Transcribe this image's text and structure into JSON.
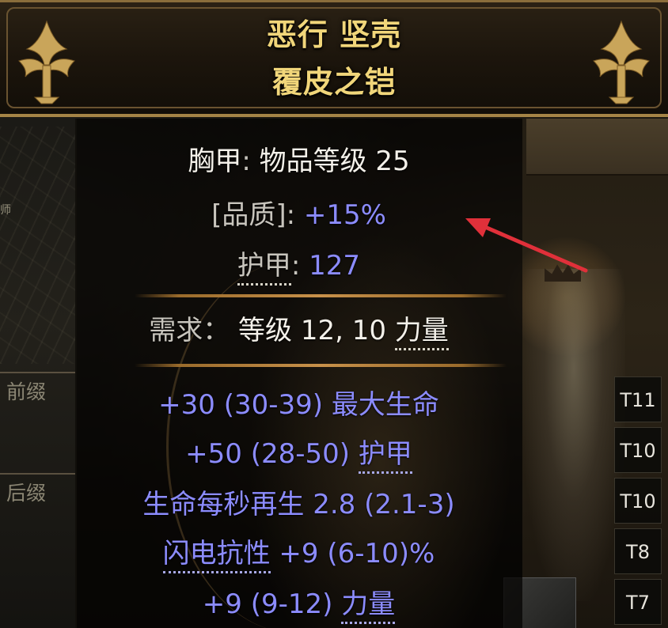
{
  "item": {
    "name_line1": "恶行 坚壳",
    "name_line2": "覆皮之铠"
  },
  "properties": {
    "type_label": "胸甲",
    "item_level_label": "物品等级",
    "item_level_value": "25",
    "quality_label": "[品质]:",
    "quality_value": "+15%",
    "armour_label": "护甲",
    "armour_value": "127"
  },
  "requirements": {
    "label": "需求：",
    "level_text": "等级 12, 10",
    "stat_text": "力量"
  },
  "modifiers": [
    {
      "prefix": "+30 (30-39) 最大生命",
      "keyword": "",
      "suffix": "",
      "tier": "T11"
    },
    {
      "prefix": "+50 (28-50) ",
      "keyword": "护甲",
      "suffix": "",
      "tier": "T10"
    },
    {
      "prefix": "生命每秒再生 2.8 (2.1-3)",
      "keyword": "",
      "suffix": "",
      "tier": "T10"
    },
    {
      "prefix": "",
      "keyword": "闪电抗性",
      "suffix": " +9 (6-10)%",
      "tier": "T8"
    },
    {
      "prefix": "+9 (9-12) ",
      "keyword": "力量",
      "suffix": "",
      "tier": "T7"
    }
  ],
  "background": {
    "prefix_label": "前缀",
    "suffix_label": "后缀",
    "small_tag": "师"
  },
  "colors": {
    "name_gold": "#f1d67a",
    "magic_blue": "#8c8cff",
    "annotation_arrow": "#e0303a"
  }
}
